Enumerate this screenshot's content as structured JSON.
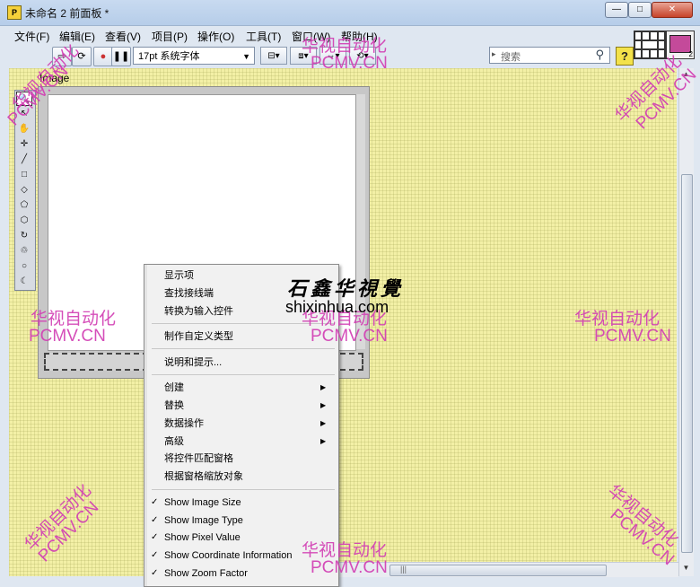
{
  "window": {
    "title": "未命名 2 前面板 *",
    "app_icon_label": "P",
    "controls": {
      "minimize": "—",
      "maximize": "□",
      "close": "✕"
    }
  },
  "menubar": {
    "items": [
      "文件(F)",
      "编辑(E)",
      "查看(V)",
      "项目(P)",
      "操作(O)",
      "工具(T)",
      "窗口(W)",
      "帮助(H)"
    ]
  },
  "toolbar": {
    "run": "⇨",
    "run_continuous": "⟳",
    "abort": "●",
    "pause": "❚❚",
    "font_value": "17pt 系统字体",
    "dropdown_arrow": "▼",
    "align_label": "⊟▾",
    "distribute_label": "⧈▾",
    "resize_label": "⇔▾",
    "reorder_label": "⟲▾",
    "help": "?"
  },
  "search": {
    "placeholder": "搜索",
    "marker": "▸",
    "icon": "search-icon"
  },
  "vi_icon_number": "2",
  "panel": {
    "control_label": "Image",
    "tools": [
      "🔍",
      "↖",
      "✋",
      "✛",
      "╱",
      "□",
      "◇",
      "⬠",
      "⬡",
      "↻",
      "♲",
      "○",
      "☾"
    ]
  },
  "context_menu": {
    "items": [
      {
        "label": "显示项",
        "check": "",
        "submenu": ""
      },
      {
        "label": "查找接线端",
        "check": "",
        "submenu": ""
      },
      {
        "label": "转换为输入控件",
        "check": "",
        "submenu": ""
      },
      {
        "label": "制作自定义类型",
        "check": "",
        "submenu": ""
      },
      {
        "label": "说明和提示...",
        "check": "",
        "submenu": ""
      },
      {
        "label": "创建",
        "check": "",
        "submenu": "▶"
      },
      {
        "label": "替换",
        "check": "",
        "submenu": "▶"
      },
      {
        "label": "数据操作",
        "check": "",
        "submenu": "▶"
      },
      {
        "label": "高级",
        "check": "",
        "submenu": "▶"
      },
      {
        "label": "将控件匹配窗格",
        "check": "",
        "submenu": ""
      },
      {
        "label": "根据窗格缩放对象",
        "check": "",
        "submenu": ""
      },
      {
        "label": "Show Image Size",
        "check": "✓",
        "submenu": ""
      },
      {
        "label": "Show Image Type",
        "check": "✓",
        "submenu": ""
      },
      {
        "label": "Show Pixel Value",
        "check": "✓",
        "submenu": ""
      },
      {
        "label": "Show Coordinate Information",
        "check": "✓",
        "submenu": ""
      },
      {
        "label": "Show Zoom Factor",
        "check": "✓",
        "submenu": ""
      }
    ]
  },
  "watermark": {
    "cn": "华视自动化",
    "en": "PCMV.CN",
    "site_logo": "石鑫华視覺",
    "site_url": "shixinhua.com",
    "color": "#d23fb4"
  }
}
